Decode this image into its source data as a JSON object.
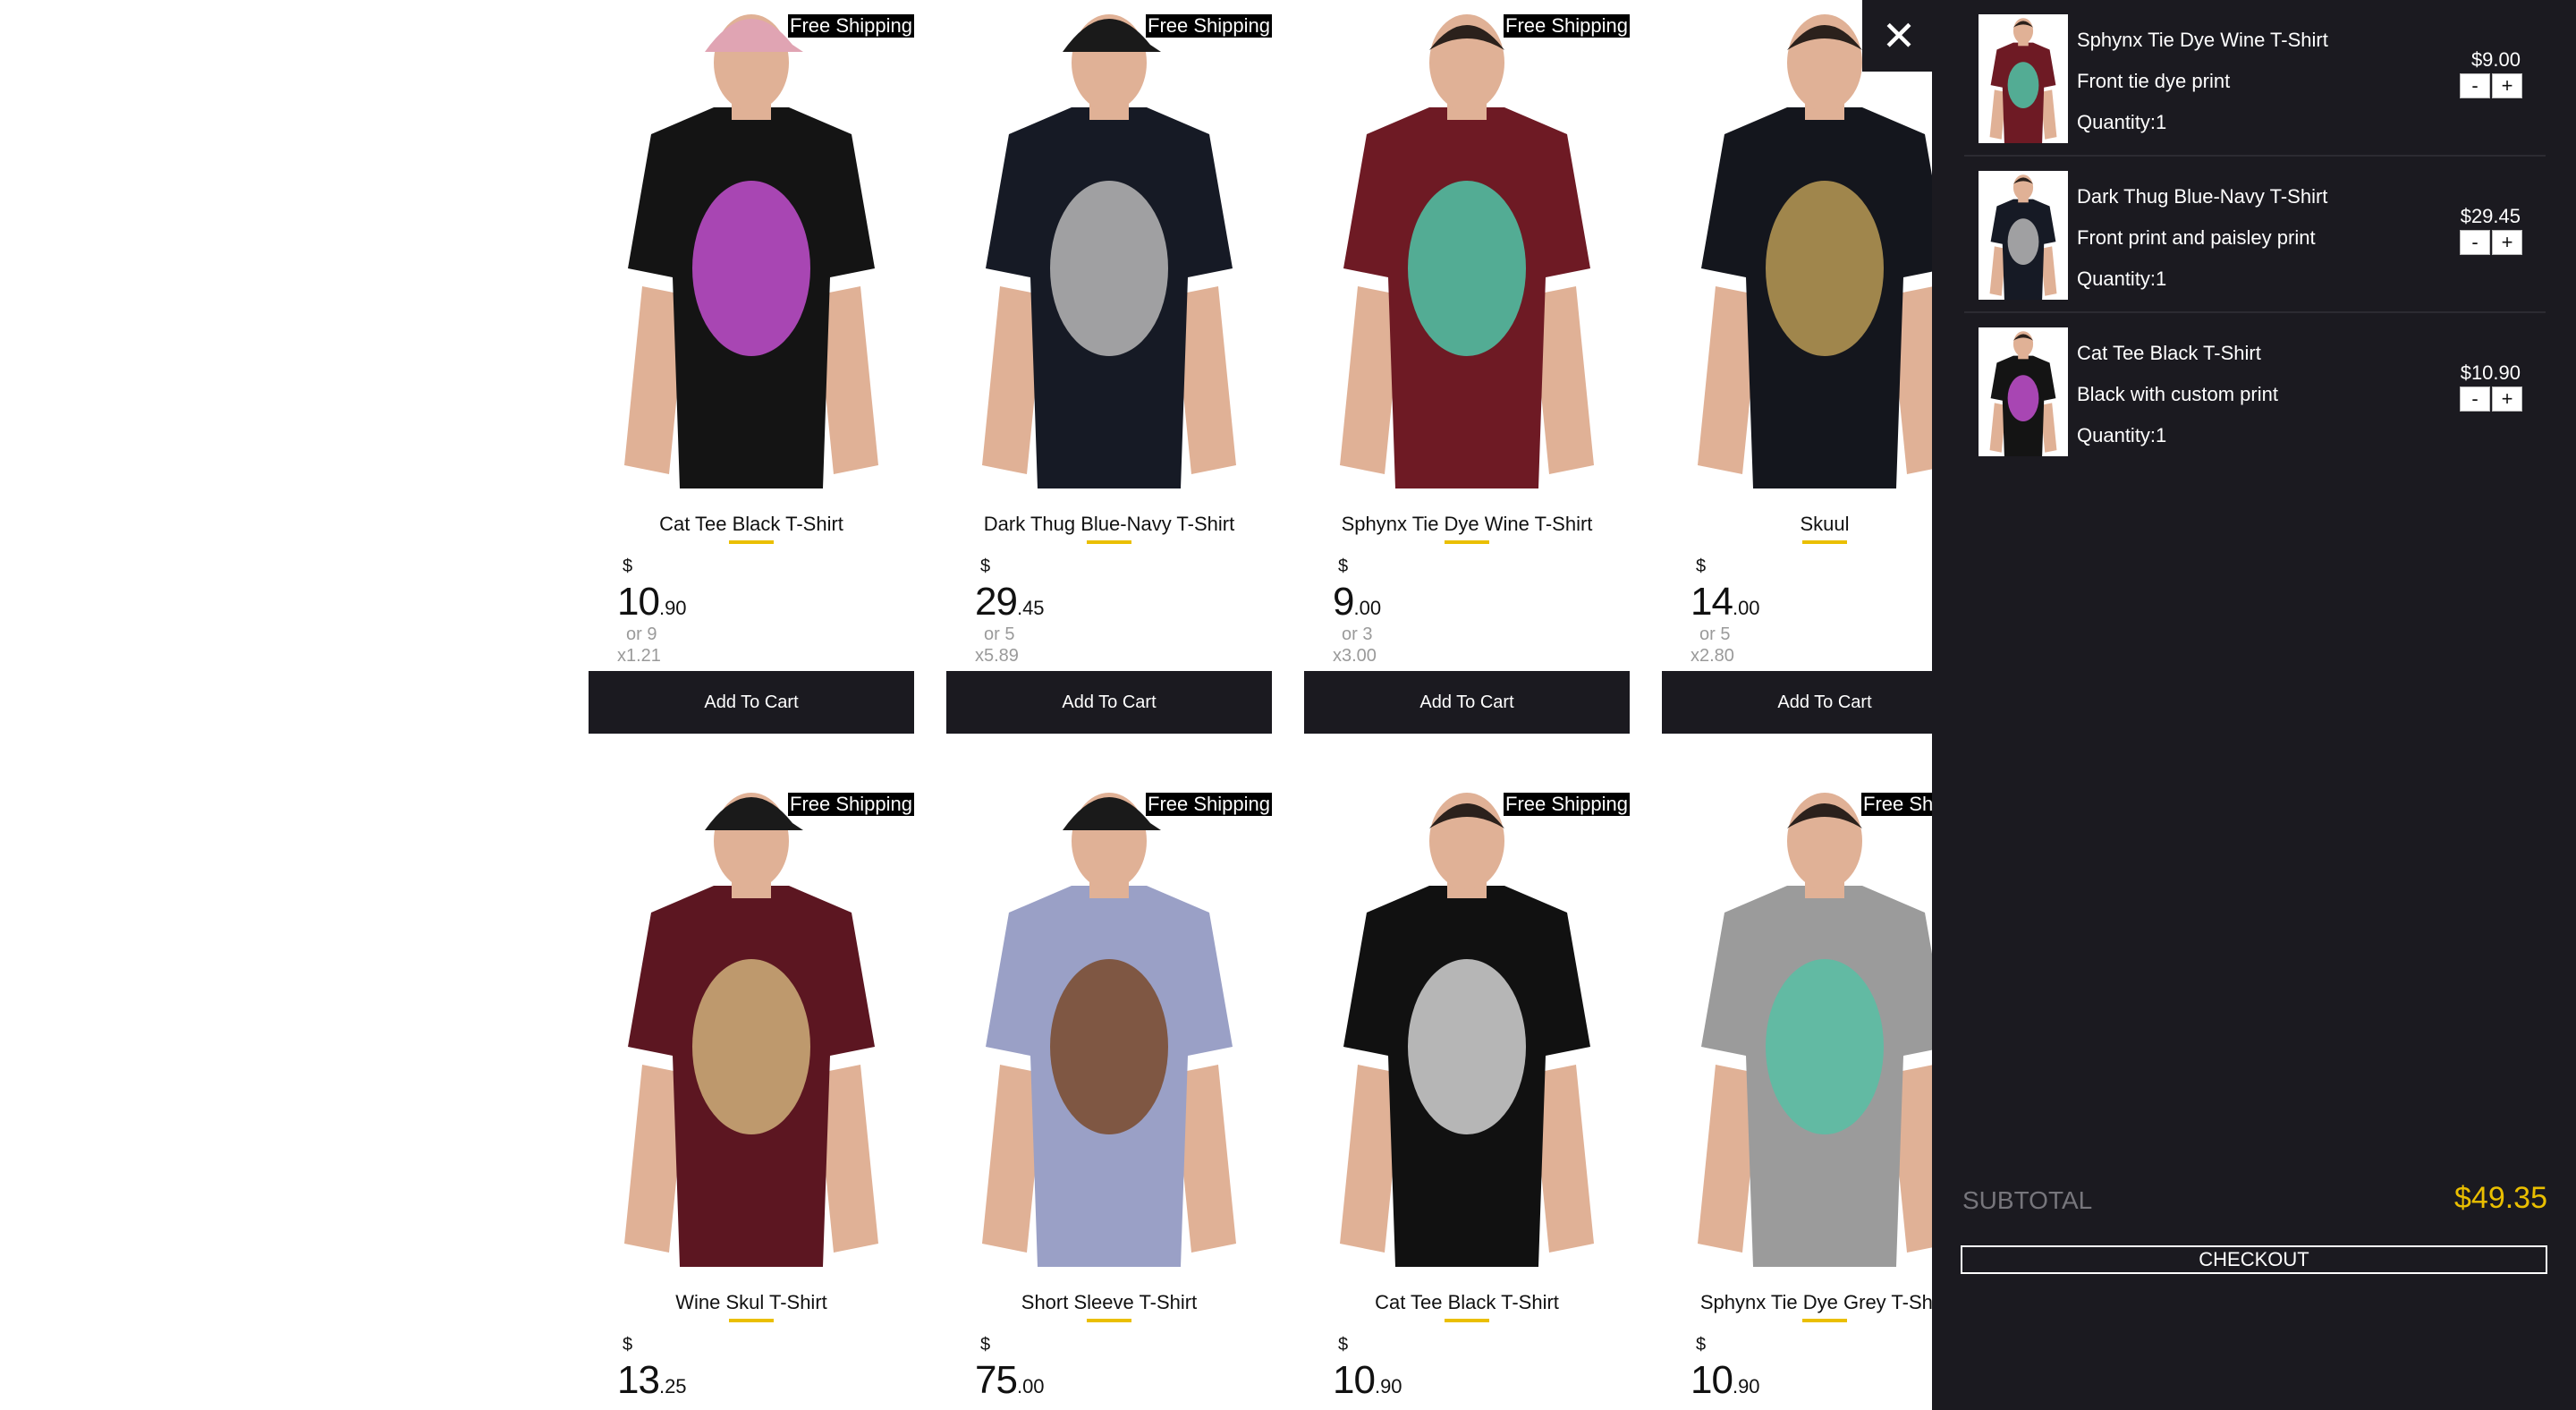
{
  "products": [
    {
      "name": "Cat Tee Black T-Shirt",
      "badge": "Free Shipping",
      "currency": "$",
      "price_int": "10",
      "price_cents": ".90",
      "installments": "or 9",
      "installment_value": "x1.21",
      "cta": "Add To Cart",
      "cap": "#e0a4b3",
      "shirt": "#141414",
      "print": "#c24fcf"
    },
    {
      "name": "Dark Thug Blue-Navy T-Shirt",
      "badge": "Free Shipping",
      "currency": "$",
      "price_int": "29",
      "price_cents": ".45",
      "installments": "or 5",
      "installment_value": "x5.89",
      "cta": "Add To Cart",
      "cap": "#1a1a1a",
      "shirt": "#161a25",
      "print": "#b8b8b8"
    },
    {
      "name": "Sphynx Tie Dye Wine T-Shirt",
      "badge": "Free Shipping",
      "currency": "$",
      "price_int": "9",
      "price_cents": ".00",
      "installments": "or 3",
      "installment_value": "x3.00",
      "cta": "Add To Cart",
      "cap": "",
      "shirt": "#6e1a24",
      "print": "#4fc7a8"
    },
    {
      "name": "Skuul",
      "badge": "",
      "currency": "$",
      "price_int": "14",
      "price_cents": ".00",
      "installments": "or 5",
      "installment_value": "x2.80",
      "cta": "Add To Cart",
      "cap": "",
      "shirt": "#14161d",
      "print": "#b89a55"
    },
    {
      "name": "Wine Skul T-Shirt",
      "badge": "Free Shipping",
      "currency": "$",
      "price_int": "13",
      "price_cents": ".25",
      "installments": "",
      "installment_value": "",
      "cta": "",
      "cap": "#1a1a1a",
      "shirt": "#5c1621",
      "print": "#cfb07a"
    },
    {
      "name": "Short Sleeve T-Shirt",
      "badge": "Free Shipping",
      "currency": "$",
      "price_int": "75",
      "price_cents": ".00",
      "installments": "",
      "installment_value": "",
      "cta": "",
      "cap": "#1a1a1a",
      "shirt": "#9aa0c6",
      "print": "#7a4a2c"
    },
    {
      "name": "Cat Tee Black T-Shirt",
      "badge": "Free Shipping",
      "currency": "$",
      "price_int": "10",
      "price_cents": ".90",
      "installments": "",
      "installment_value": "",
      "cta": "",
      "cap": "",
      "shirt": "#111111",
      "print": "#d4d4d4"
    },
    {
      "name": "Sphynx Tie Dye Grey T-Shirt",
      "badge": "Free Shipping",
      "currency": "$",
      "price_int": "10",
      "price_cents": ".90",
      "installments": "",
      "installment_value": "",
      "cta": "",
      "cap": "",
      "shirt": "#9b9b9b",
      "print": "#58c0a4"
    }
  ],
  "cart": {
    "close_icon": "close-icon",
    "items": [
      {
        "title": "Sphynx Tie Dye Wine T-Shirt",
        "description": "Front tie dye print",
        "quantity": "Quantity:1",
        "price": "$9.00",
        "minus": "-",
        "plus": "+",
        "shirt": "#6e1a24",
        "print": "#4fc7a8"
      },
      {
        "title": "Dark Thug Blue-Navy T-Shirt",
        "description": "Front print and paisley print",
        "quantity": "Quantity:1",
        "price": "$29.45",
        "minus": "-",
        "plus": "+",
        "shirt": "#161a25",
        "print": "#b8b8b8"
      },
      {
        "title": "Cat Tee Black T-Shirt",
        "description": "Black with custom print",
        "quantity": "Quantity:1",
        "price": "$10.90",
        "minus": "-",
        "plus": "+",
        "shirt": "#141414",
        "print": "#c24fcf"
      }
    ],
    "subtotal_label": "SUBTOTAL",
    "subtotal_value": "$49.35",
    "checkout_label": "CHECKOUT"
  },
  "colors": {
    "accent": "#eabf00",
    "drawer_bg": "#1b1a20",
    "button_bg": "#1b1a20"
  }
}
